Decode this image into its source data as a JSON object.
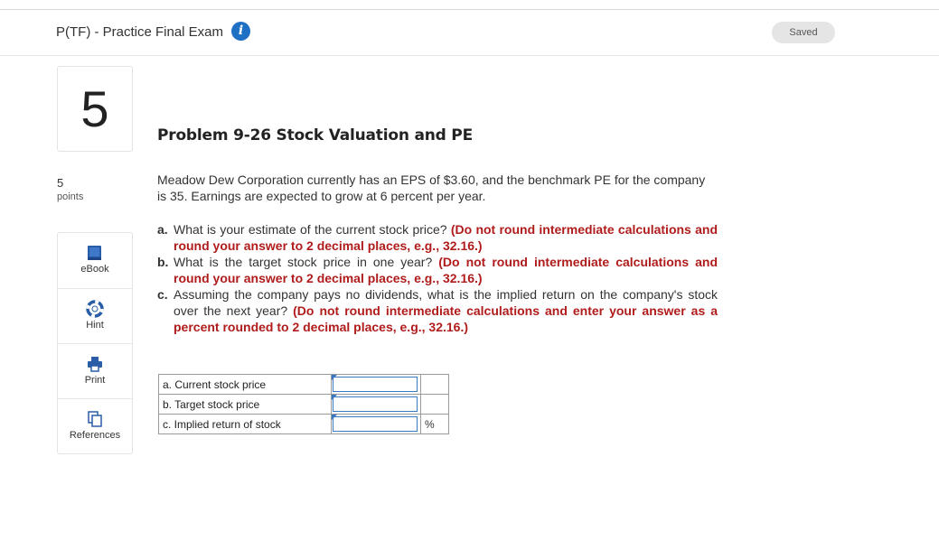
{
  "header": {
    "title": "P(TF) - Practice Final Exam",
    "info_glyph": "i",
    "saved": "Saved"
  },
  "question": {
    "number": "5",
    "points_value": "5",
    "points_label": "points"
  },
  "tools": [
    {
      "label": "eBook",
      "icon": "book-icon"
    },
    {
      "label": "Hint",
      "icon": "lifebuoy-icon"
    },
    {
      "label": "Print",
      "icon": "printer-icon"
    },
    {
      "label": "References",
      "icon": "copy-icon"
    }
  ],
  "problem": {
    "title": "Problem 9-26 Stock Valuation and PE",
    "intro": "Meadow Dew Corporation currently has an EPS of $3.60, and the benchmark PE for the company is 35. Earnings are expected to grow at 6 percent per year.",
    "items": [
      {
        "letter": "a.",
        "text": "What is your estimate of the current stock price? ",
        "note": "(Do not round intermediate calculations and round your answer to 2 decimal places, e.g., 32.16.)"
      },
      {
        "letter": "b.",
        "text": "What is the target stock price in one year? ",
        "note": "(Do not round intermediate calculations and round your answer to 2 decimal places, e.g., 32.16.)"
      },
      {
        "letter": "c.",
        "text": "Assuming the company pays no dividends, what is the implied return on the company's stock over the next year? ",
        "note": "(Do not round intermediate calculations and enter your answer as a percent rounded to 2 decimal places, e.g., 32.16.)"
      }
    ]
  },
  "answers": {
    "rows": [
      {
        "label": "a. Current stock price",
        "value": "",
        "unit": ""
      },
      {
        "label": "b. Target stock price",
        "value": "",
        "unit": ""
      },
      {
        "label": "c. Implied return of stock",
        "value": "",
        "unit": "%"
      }
    ]
  },
  "colors": {
    "accent": "#1f6fc5",
    "instruction_red": "#b01c1c",
    "input_border": "#3a78c2"
  }
}
